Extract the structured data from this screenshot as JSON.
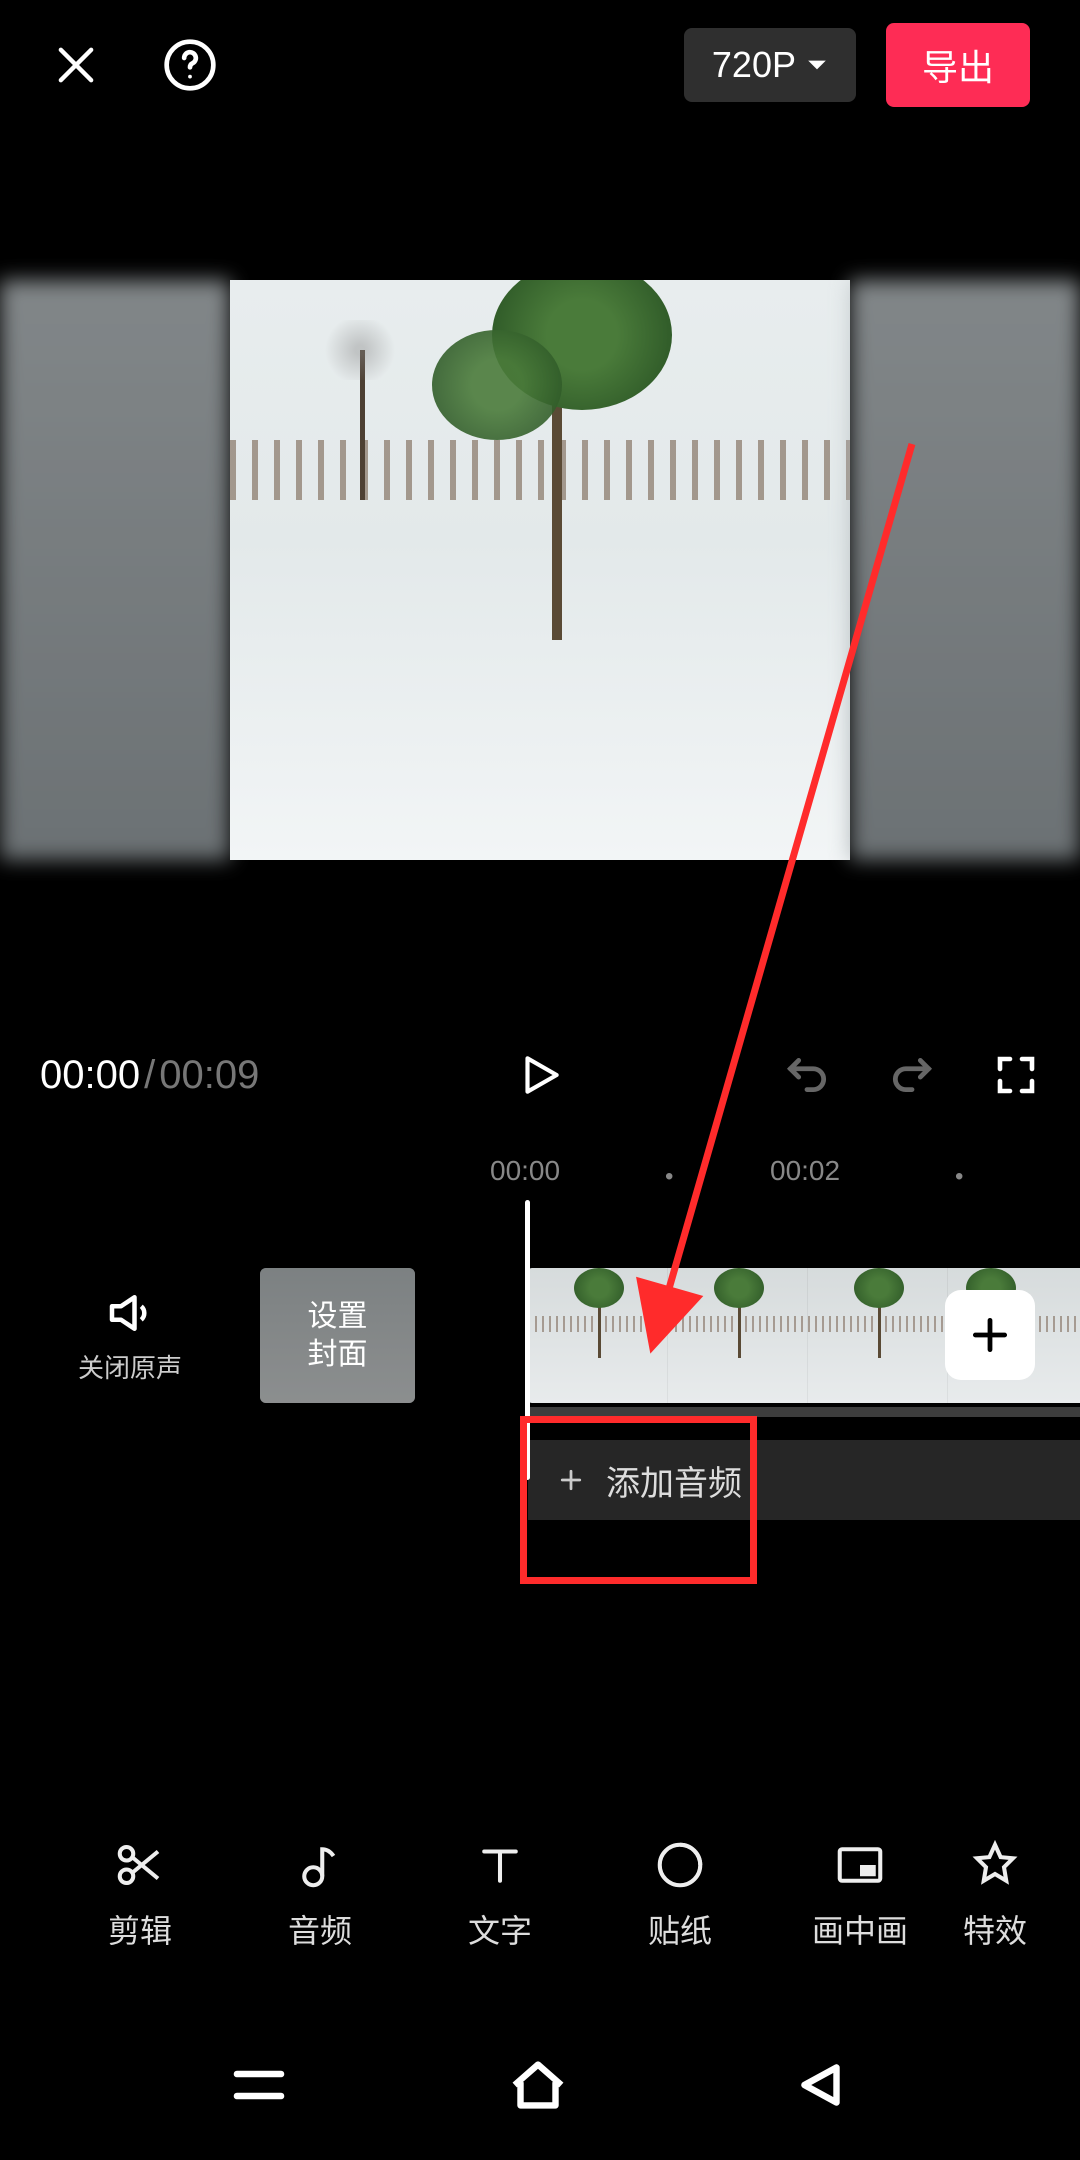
{
  "topbar": {
    "resolution_label": "720P",
    "export_label": "导出"
  },
  "playback": {
    "current_time": "00:00",
    "total_time": "00:09"
  },
  "ruler": {
    "t0": "00:00",
    "t2": "00:02"
  },
  "track": {
    "mute_label": "关闭原声",
    "cover_label": "设置\n封面"
  },
  "audio": {
    "add_label": "添加音频"
  },
  "tools": [
    {
      "id": "edit",
      "label": "剪辑"
    },
    {
      "id": "audio",
      "label": "音频"
    },
    {
      "id": "text",
      "label": "文字"
    },
    {
      "id": "sticker",
      "label": "贴纸"
    },
    {
      "id": "pip",
      "label": "画中画"
    },
    {
      "id": "effect",
      "label": "特效"
    }
  ]
}
